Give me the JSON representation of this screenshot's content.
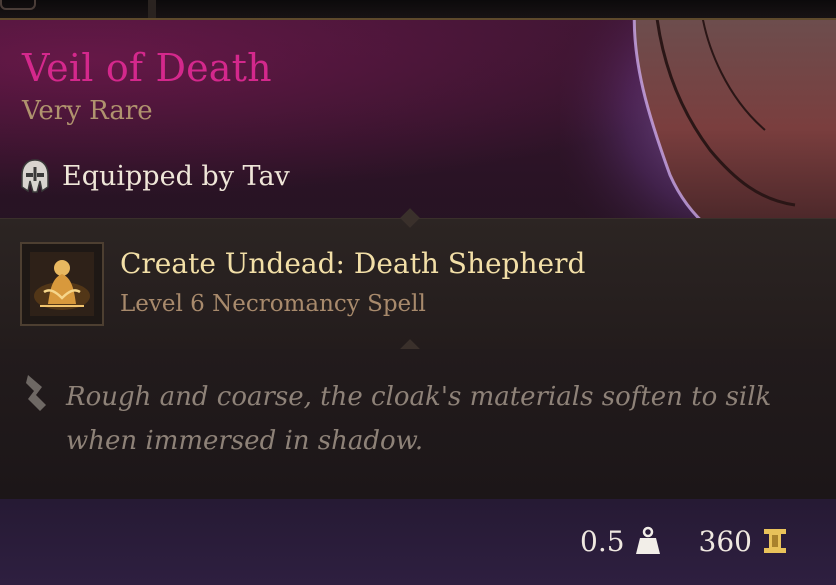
{
  "item": {
    "name": "Veil of Death",
    "rarity": "Very Rare",
    "equipped_label": "Equipped by Tav"
  },
  "spell": {
    "name": "Create Undead: Death Shepherd",
    "level": "Level 6 Necromancy Spell"
  },
  "description": "Rough and coarse, the cloak's materials soften to silk when immersed in shadow.",
  "footer": {
    "weight": "0.5",
    "price": "360"
  },
  "icons": {
    "equipped": "helmet-icon",
    "spell": "necromancy-spell-icon",
    "description": "quill-icon",
    "weight": "weight-icon",
    "price": "gold-coin-icon"
  },
  "colors": {
    "title": "#d4288c",
    "rarity": "#b0936e",
    "spell_name": "#f2dfa7",
    "spell_level": "#a88a6c",
    "description": "#8e8278"
  }
}
